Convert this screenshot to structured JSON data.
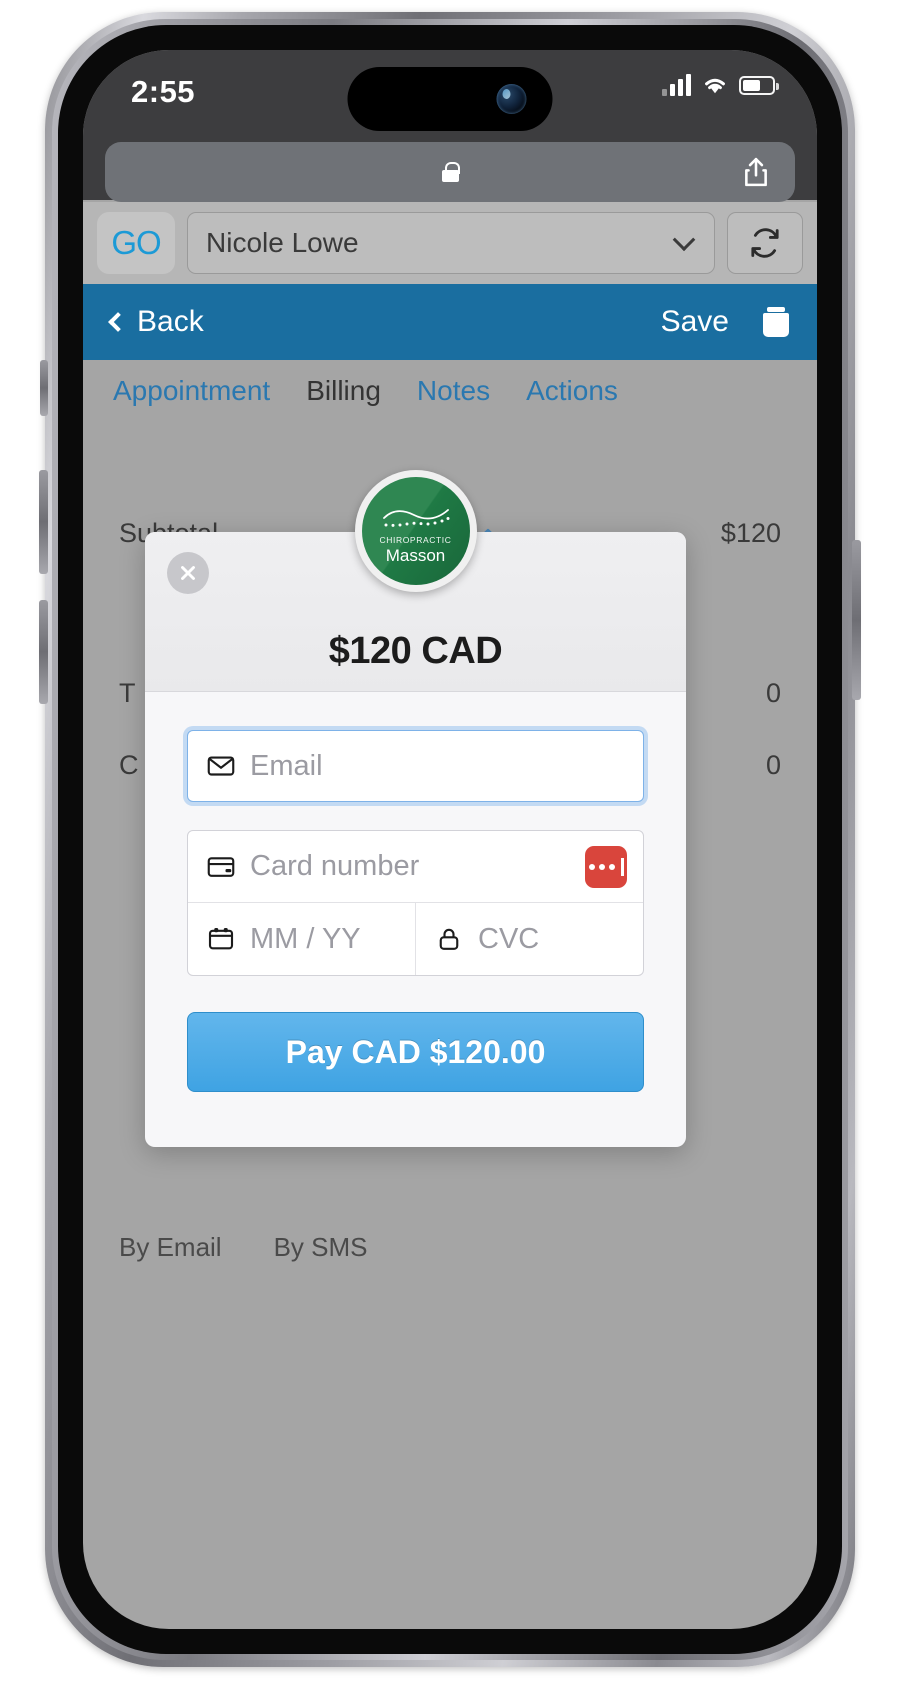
{
  "status_bar": {
    "time": "2:55",
    "signal_icon": "cellular-bars-icon",
    "wifi_icon": "wifi-icon",
    "battery_icon": "battery-icon"
  },
  "browser": {
    "lock_icon": "lock-icon",
    "share_icon": "share-icon",
    "url_text": ""
  },
  "app_header": {
    "logo_text": "GO",
    "client_name": "Nicole Lowe",
    "refresh_icon": "refresh-icon",
    "dropdown_icon": "chevron-down-icon"
  },
  "nav_bar": {
    "back_label": "Back",
    "save_label": "Save",
    "delete_icon": "trash-icon",
    "back_icon": "chevron-left-icon",
    "background_color": "#1a6ea0"
  },
  "tabs": [
    {
      "label": "Appointment",
      "active": false
    },
    {
      "label": "Billing",
      "active": true
    },
    {
      "label": "Notes",
      "active": false
    },
    {
      "label": "Actions",
      "active": false
    }
  ],
  "billing": {
    "rows": [
      {
        "label": "Subtotal",
        "amount": "$120"
      },
      {
        "label": "T",
        "amount": "0"
      },
      {
        "label": "C",
        "amount": "0"
      }
    ],
    "edit_icon": "edit-pencil-icon",
    "send_links": [
      "By Email",
      "By SMS"
    ]
  },
  "checkout_modal": {
    "close_icon": "close-x-icon",
    "merchant": {
      "kicker": "CHIROPRACTIC",
      "name": "Masson",
      "brand_color": "#2f8752"
    },
    "amount_heading": "$120 CAD",
    "email_field": {
      "placeholder": "Email",
      "value": "",
      "icon": "envelope-icon",
      "focused": true
    },
    "card_number_field": {
      "placeholder": "Card number",
      "value": "",
      "icon": "credit-card-icon"
    },
    "autofill_button": {
      "icon": "password-manager-icon",
      "color": "#d9453c"
    },
    "expiry_field": {
      "placeholder": "MM / YY",
      "value": "",
      "icon": "calendar-icon"
    },
    "cvc_field": {
      "placeholder": "CVC",
      "value": "",
      "icon": "lock-icon"
    },
    "pay_button": {
      "label": "Pay CAD $120.00",
      "color": "#3fa3e3"
    }
  }
}
